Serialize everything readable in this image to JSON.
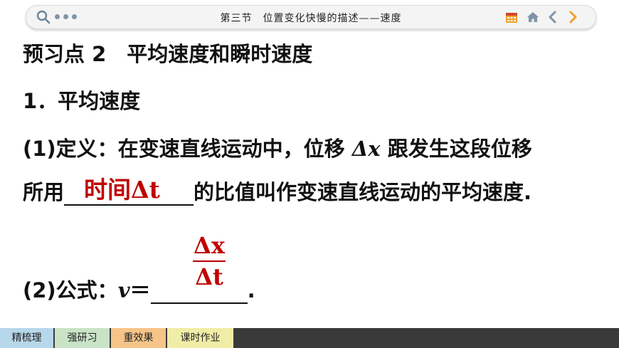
{
  "header": {
    "title": "第三节　位置变化快慢的描述——速度"
  },
  "content": {
    "heading": "预习点 2　平均速度和瞬时速度",
    "subheading": "1．平均速度",
    "line1_a": "(1)定义：在变速直线运动中，位移 ",
    "line1_sym": "Δx",
    "line1_b": " 跟发生这段位移",
    "line2_a": "所用",
    "line2_b": "的比值叫作变速直线运动的平均速度.",
    "answer1_a": "时间",
    "answer1_b": "Δt",
    "line3_a": "(2)公式：",
    "line3_v": "v",
    "line3_eq": "＝",
    "line3_end": ".",
    "fraction_num": "Δx",
    "fraction_den": "Δt"
  },
  "nav": {
    "tabs": [
      {
        "label": "精梳理",
        "color": "#b7d7ea"
      },
      {
        "label": "强研习",
        "color": "#c9e3c6"
      },
      {
        "label": "重效果",
        "color": "#f6c488"
      },
      {
        "label": "课时作业",
        "color": "#f1eda6"
      }
    ]
  },
  "colors": {
    "answer": "#c00000",
    "icon_gray": "#7f93a8",
    "icon_orange": "#f0a030"
  }
}
